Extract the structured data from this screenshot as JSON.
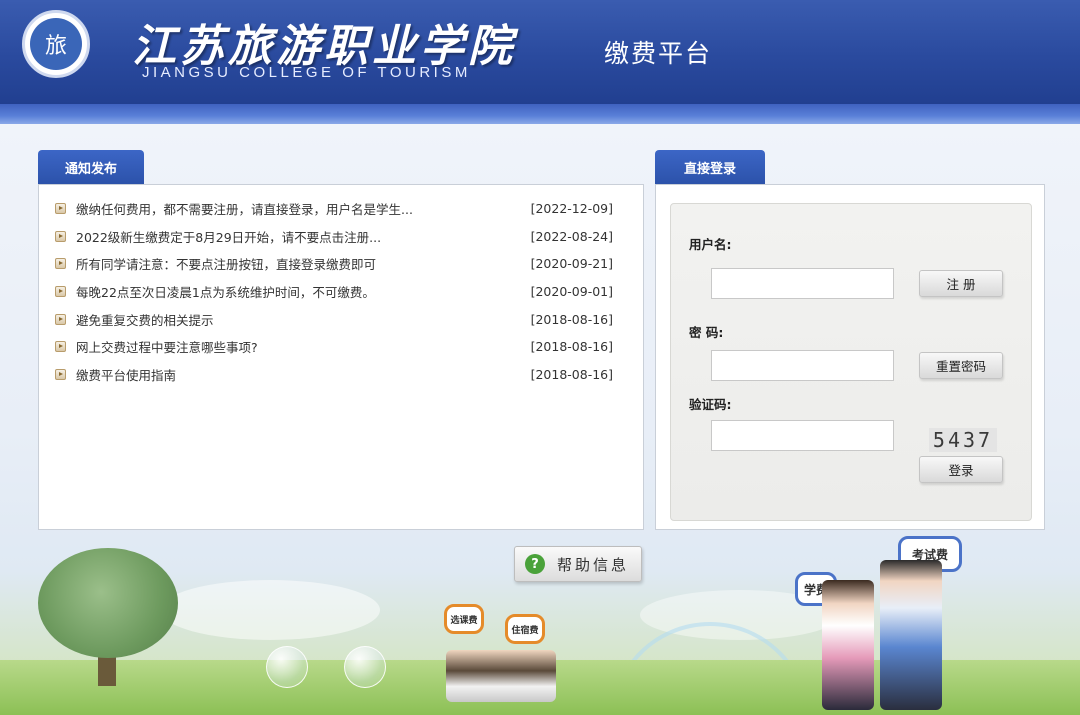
{
  "header": {
    "logo_glyph": "旅",
    "college_name_cn": "江苏旅游职业学院",
    "college_name_en": "JIANGSU COLLEGE OF TOURISM",
    "platform_title": "缴费平台"
  },
  "notices": {
    "tab_label": "通知发布",
    "items": [
      {
        "title": "缴纳任何费用，都不需要注册，请直接登录，用户名是学生...",
        "date": "[2022-12-09]"
      },
      {
        "title": "2022级新生缴费定于8月29日开始，请不要点击注册...",
        "date": "[2022-08-24]"
      },
      {
        "title": "所有同学请注意：不要点注册按钮，直接登录缴费即可",
        "date": "[2020-09-21]"
      },
      {
        "title": "每晚22点至次日凌晨1点为系统维护时间，不可缴费。",
        "date": "[2020-09-01]"
      },
      {
        "title": "避免重复交费的相关提示",
        "date": "[2018-08-16]"
      },
      {
        "title": "网上交费过程中要注意哪些事项?",
        "date": "[2018-08-16]"
      },
      {
        "title": "缴费平台使用指南",
        "date": "[2018-08-16]"
      }
    ]
  },
  "login": {
    "tab_label": "直接登录",
    "username_label": "用户名:",
    "username_value": "",
    "register_label": "注 册",
    "password_label": "密 码:",
    "password_value": "",
    "reset_password_label": "重置密码",
    "captcha_label": "验证码:",
    "captcha_value": "",
    "captcha_text": "5437",
    "login_label": "登录"
  },
  "help": {
    "label": "帮助信息",
    "icon": "question-icon",
    "icon_glyph": "?"
  },
  "scenery": {
    "bubble_tuition": "学费",
    "bubble_exam_fee": "考试费",
    "bubble_course_fee": "选课费",
    "bubble_dorm_fee": "住宿费"
  },
  "colors": {
    "header_blue": "#2a4a9e",
    "tab_blue": "#2c52aa",
    "help_green": "#4aa23a"
  }
}
